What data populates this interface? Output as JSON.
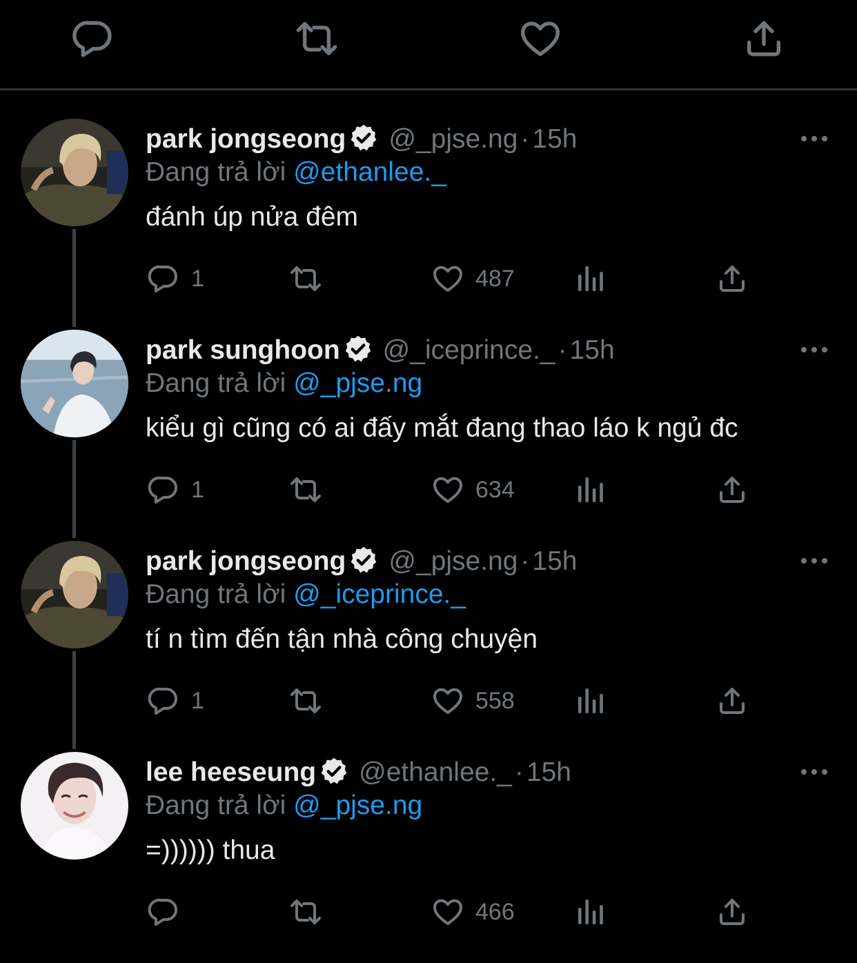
{
  "colors": {
    "background": "#000000",
    "text": "#e7e9ea",
    "muted": "#71767b",
    "link": "#1d9bf0",
    "divider": "#2f3336"
  },
  "top_actions": [
    "reply-icon",
    "retweet-icon",
    "like-icon",
    "share-icon"
  ],
  "tweets": [
    {
      "name": "park jongseong",
      "handle": "@_pjse.ng",
      "dot": "·",
      "time": "15h",
      "replying_prefix": "Đang trả lời",
      "replying_to": "@ethanlee._",
      "text": "đánh úp nửa đêm",
      "replies": "1",
      "likes": "487"
    },
    {
      "name": "park sunghoon",
      "handle": "@_iceprince._",
      "dot": "·",
      "time": "15h",
      "replying_prefix": "Đang trả lời",
      "replying_to": "@_pjse.ng",
      "text": "kiểu gì cũng có ai đấy mắt đang thao láo k ngủ đc",
      "replies": "1",
      "likes": "634"
    },
    {
      "name": "park jongseong",
      "handle": "@_pjse.ng",
      "dot": "·",
      "time": "15h",
      "replying_prefix": "Đang trả lời",
      "replying_to": "@_iceprince._",
      "text": "tí n tìm đến tận nhà công chuyện",
      "replies": "1",
      "likes": "558"
    },
    {
      "name": "lee heeseung",
      "handle": "@ethanlee._",
      "dot": "·",
      "time": "15h",
      "replying_prefix": "Đang trả lời",
      "replying_to": "@_pjse.ng",
      "text": "=)))))) thua",
      "replies": "",
      "likes": "466"
    }
  ]
}
